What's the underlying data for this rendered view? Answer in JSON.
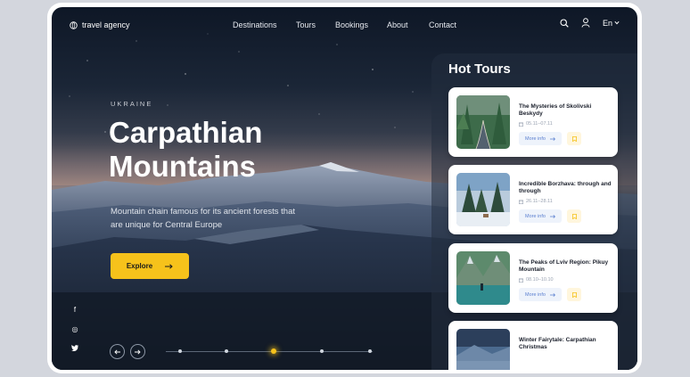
{
  "brand": {
    "name": "travel agency",
    "icon": "globe-icon"
  },
  "nav": {
    "items": [
      {
        "label": "Destinations"
      },
      {
        "label": "Tours"
      },
      {
        "label": "Bookings"
      },
      {
        "label": "About"
      },
      {
        "label": "Contact"
      }
    ],
    "language": "En",
    "icons": [
      "search-icon",
      "user-icon",
      "chevron-down-icon"
    ]
  },
  "hero": {
    "country": "UKRAINE",
    "title_line1": "Carpathian",
    "title_line2": "Mountains",
    "description": "Mountain chain famous for its ancient forests that are unique for Central Europe",
    "cta_label": "Explore",
    "accent": "#f6c21b"
  },
  "social": [
    {
      "icon": "facebook-icon",
      "glyph": "f"
    },
    {
      "icon": "instagram-icon",
      "glyph": "◎"
    },
    {
      "icon": "twitter-icon",
      "glyph": "🐦"
    }
  ],
  "slider": {
    "slides": 5,
    "active_index": 2
  },
  "hot_tours": {
    "title": "Hot Tours",
    "more_label": "More info",
    "cards": [
      {
        "title": "The Mysteries of Skolivski Beskydy",
        "date": "05.11–07.11"
      },
      {
        "title": "Incredible Borzhava: through and through",
        "date": "26.11–28.11"
      },
      {
        "title": "The Peaks of Lviv Region: Pikuy Mountain",
        "date": "08.10–10.10"
      },
      {
        "title": "Winter Fairytale: Carpathian Christmas",
        "date": ""
      }
    ]
  }
}
